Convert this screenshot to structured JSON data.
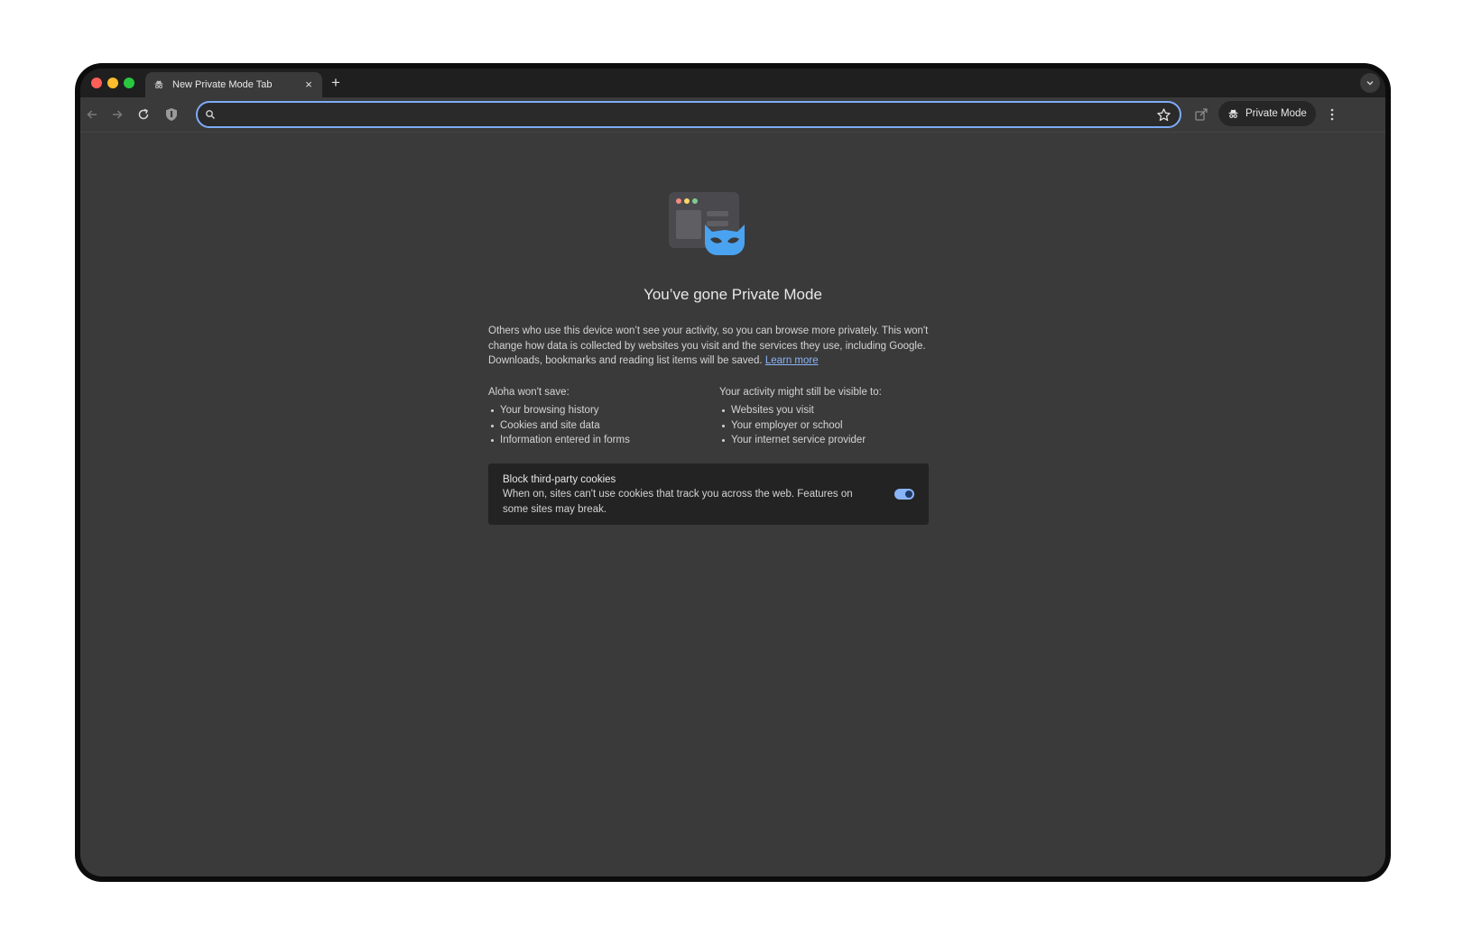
{
  "browser": {
    "tab_title": "New Private Mode Tab",
    "tab_close": "×",
    "new_tab": "+",
    "omnibox_value": "",
    "private_mode_label": "Private Mode"
  },
  "page": {
    "headline": "You’ve gone Private Mode",
    "description": "Others who use this device won’t see your activity, so you can browse more privately. This won't change how data is collected by websites you visit and the services they use, including Google. Downloads, bookmarks and reading list items will be saved.",
    "learn_more": "Learn more",
    "wont_save": {
      "heading": "Aloha won't save:",
      "items": [
        "Your browsing history",
        "Cookies and site data",
        "Information entered in forms"
      ]
    },
    "still_visible": {
      "heading": "Your activity might still be visible to:",
      "items": [
        "Websites you visit",
        "Your employer or school",
        "Your internet service provider"
      ]
    },
    "cookies": {
      "title": "Block third-party cookies",
      "description": "When on, sites can't use cookies that track you across the web. Features on some sites may break.",
      "enabled": true
    }
  },
  "colors": {
    "accent": "#8ab4f8",
    "mascot": "#4aa3f0",
    "page_bg": "#3a3a3a",
    "titlebar_bg": "#1f1f1f"
  },
  "icons": {
    "tab": "incognito-icon",
    "back": "arrow-left-icon",
    "forward": "arrow-right-icon",
    "reload": "reload-icon",
    "shield": "shield-icon",
    "search": "search-icon",
    "bookmark": "star-icon",
    "share": "share-icon",
    "menu": "kebab-menu-icon",
    "tab_search": "chevron-down-icon"
  }
}
